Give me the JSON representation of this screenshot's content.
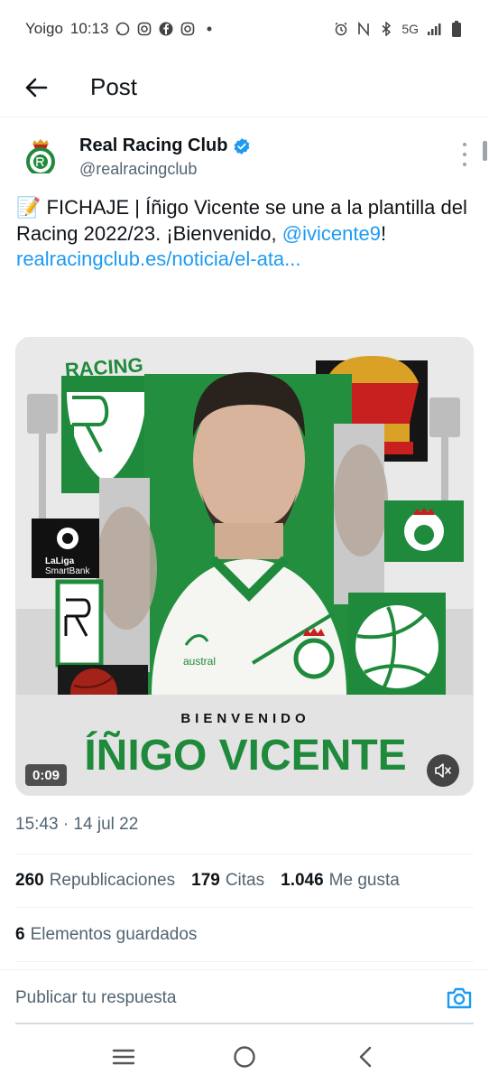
{
  "status_bar": {
    "carrier": "Yoigo",
    "time": "10:13",
    "network": "5G",
    "icons_left": [
      "whatsapp-icon",
      "instagram-icon",
      "facebook-icon",
      "instagram-icon",
      "dot-icon"
    ],
    "icons_right": [
      "alarm-icon",
      "nfc-icon",
      "bluetooth-icon",
      "signal-icon",
      "battery-icon"
    ]
  },
  "header": {
    "title": "Post"
  },
  "author": {
    "name": "Real Racing Club",
    "handle": "@realracingclub",
    "verified": true
  },
  "tweet": {
    "emoji": "📝",
    "text_part1": " FICHAJE | Íñigo Vicente se une a la plantilla del Racing 2022/23. ¡Bienvenido, ",
    "mention": "@ivicente9",
    "text_part2": "! ",
    "link": "realracingclub.es/noticia/el-ata..."
  },
  "media": {
    "type": "video",
    "duration": "0:09",
    "overlay_small": "BIENVENIDO",
    "overlay_name": "ÍÑIGO VICENTE",
    "racing_wordmark": "RACING",
    "laliga_line1": "LaLiga",
    "laliga_line2": "SmartBank",
    "kit_brand": "austral",
    "colors": {
      "green": "#1f8a3b",
      "red": "#c8201f",
      "gold": "#d9a126"
    }
  },
  "timestamp": "15:43 · 14 jul 22",
  "stats": {
    "reposts_count": "260",
    "reposts_label": "Republicaciones",
    "quotes_count": "179",
    "quotes_label": "Citas",
    "likes_count": "1.046",
    "likes_label": "Me gusta"
  },
  "bookmarks": {
    "count": "6",
    "label": "Elementos guardados"
  },
  "reply": {
    "placeholder": "Publicar tu respuesta"
  },
  "colors": {
    "accent": "#1d9bf0",
    "text_secondary": "#536471",
    "divider": "#eff3f4"
  }
}
